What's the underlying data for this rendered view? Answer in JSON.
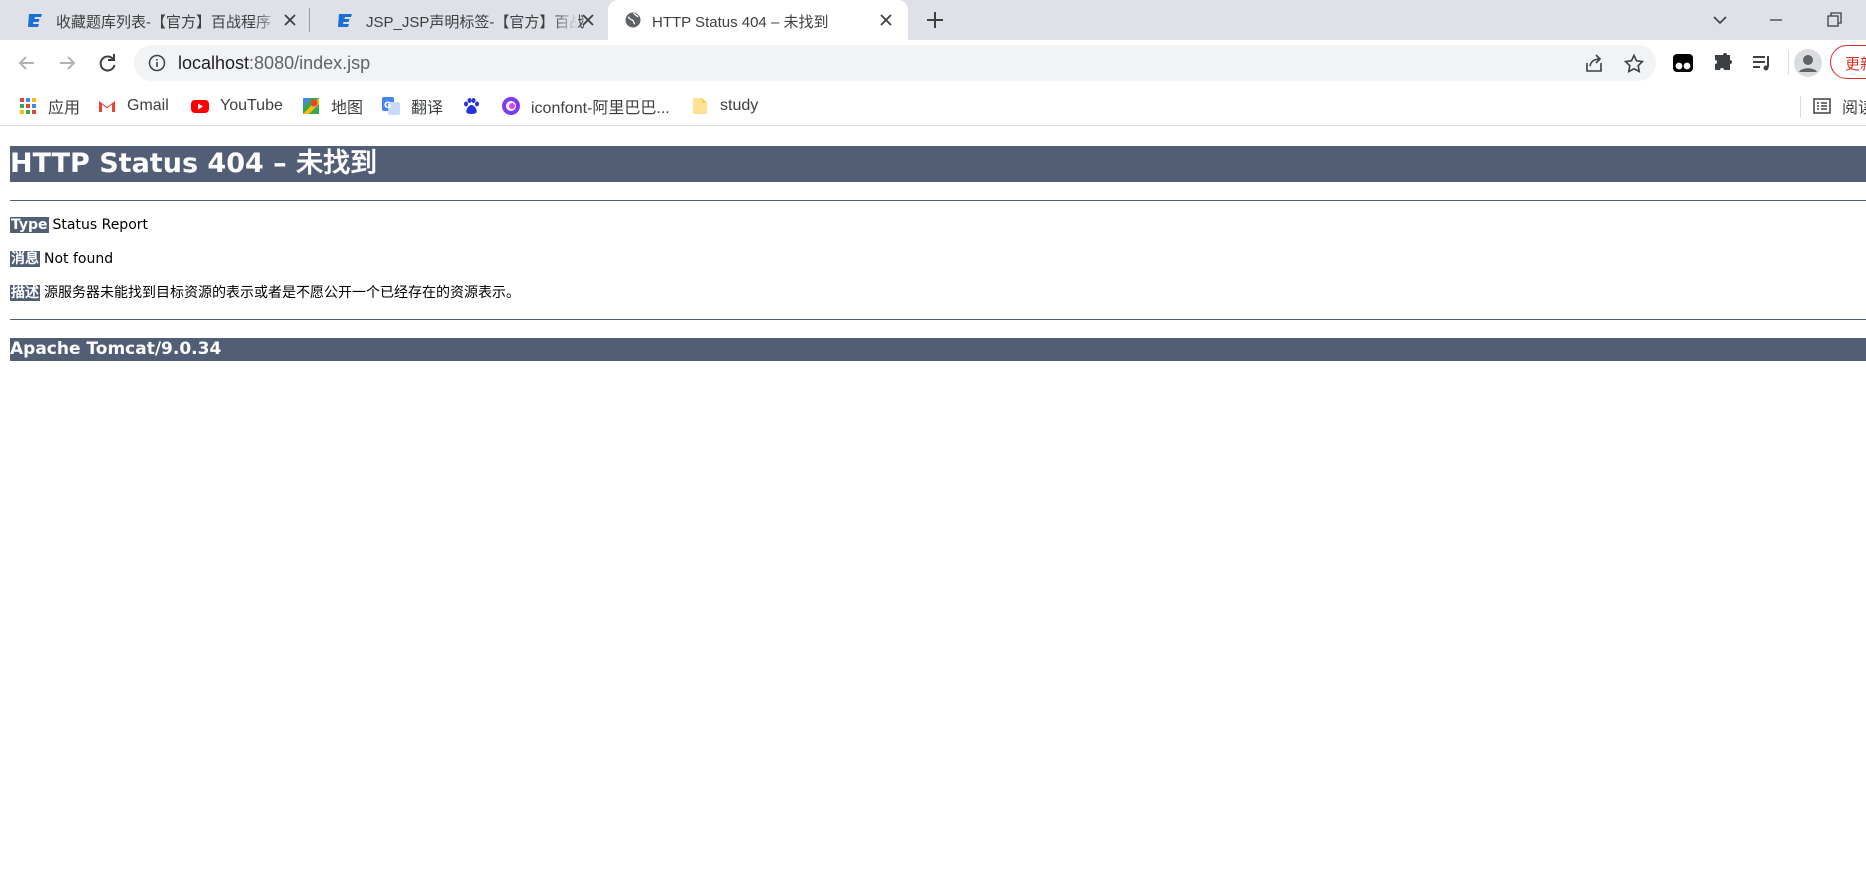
{
  "browser": {
    "tabs": [
      {
        "title": "收藏题库列表-【官方】百战程序",
        "active": false
      },
      {
        "title": "JSP_JSP声明标签-【官方】百战程",
        "active": false
      },
      {
        "title": "HTTP Status 404 – 未找到",
        "active": true
      }
    ],
    "address": {
      "host": "localhost",
      "rest": ":8080/index.jsp"
    },
    "update_label": "更新",
    "reading_list_label": "阅读",
    "bookmarks": [
      {
        "label": "应用",
        "icon": "apps-grid-icon"
      },
      {
        "label": "Gmail",
        "icon": "gmail-icon"
      },
      {
        "label": "YouTube",
        "icon": "youtube-icon"
      },
      {
        "label": "地图",
        "icon": "maps-icon"
      },
      {
        "label": "翻译",
        "icon": "translate-icon"
      },
      {
        "label": "",
        "icon": "baidu-paw-icon"
      },
      {
        "label": "iconfont-阿里巴巴...",
        "icon": "iconfont-icon"
      },
      {
        "label": "study",
        "icon": "folder-icon"
      }
    ],
    "colors": {
      "tabstrip": "#dee1e6",
      "omnibox": "#f1f3f4",
      "update_red": "#d93025"
    }
  },
  "page": {
    "heading": "HTTP Status 404 – 未找到",
    "type_label": "Type",
    "type_value": "Status Report",
    "message_label": "消息",
    "message_value": "Not found",
    "description_label": "描述",
    "description_value": "源服务器未能找到目标资源的表示或者是不愿公开一个已经存在的资源表示。",
    "footer": "Apache Tomcat/9.0.34",
    "colors": {
      "header_bg": "#525d76",
      "header_text": "#ffffff"
    }
  }
}
